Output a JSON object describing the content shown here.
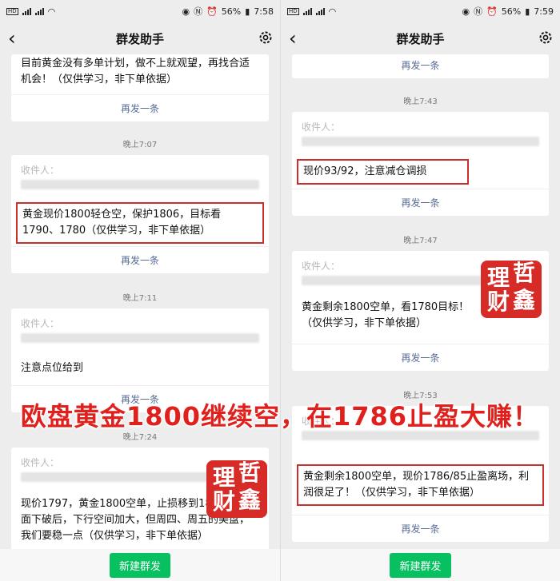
{
  "left": {
    "status": {
      "time": "7:58",
      "battery": "56%"
    },
    "nav": {
      "back": "‹",
      "title": "群发助手"
    },
    "cards": [
      {
        "message": "目前黄金没有多单计划，做不上就观望，再找合适机会！（仅供学习，非下单依据）",
        "resend": "再发一条"
      },
      {
        "time": "晚上7:07",
        "recipients": "收件人：",
        "message": "黄金现价1800轻仓空，保护1806，目标看1790、1780（仅供学习，非下单依据）",
        "resend": "再发一条"
      },
      {
        "time": "晚上7:11",
        "recipients": "收件人：",
        "message": "注意点位给到",
        "resend": "再发一条"
      },
      {
        "time": "晚上7:24",
        "recipients": "收件人：",
        "message": "现价1797，黄金1800空单，止损移到1803。技术面下破后，下行空间加大，但周四、周五的美盘，我们要稳一点（仅供学习，非下单依据）"
      }
    ],
    "new_button": "新建群发"
  },
  "right": {
    "status": {
      "time": "7:59",
      "battery": "56%"
    },
    "nav": {
      "back": "‹",
      "title": "群发助手"
    },
    "cards": [
      {
        "resend": "再发一条"
      },
      {
        "time": "晚上7:43",
        "recipients": "收件人：",
        "message": "现价93/92，注意减仓调损",
        "resend": "再发一条"
      },
      {
        "time": "晚上7:47",
        "recipients": "收件人：",
        "message": "黄金剩余1800空单，看1780目标！（仅供学习，非下单依据）",
        "resend": "再发一条"
      },
      {
        "time": "晚上7:53",
        "recipients": "收件人：",
        "message": "黄金剩余1800空单，现价1786/85止盈离场，利润很足了！（仅供学习，非下单依据）",
        "resend": "再发一条"
      }
    ],
    "new_button": "新建群发"
  },
  "overlay": {
    "banner": "欧盘黄金1800继续空，在1786止盈大赚！",
    "seal_chars": [
      "理",
      "哲",
      "财",
      "鑫"
    ]
  },
  "colors": {
    "accent": "#576b95",
    "highlight": "#c9302c",
    "button": "#07c160",
    "banner": "#e0201c",
    "seal": "#d62b27"
  }
}
